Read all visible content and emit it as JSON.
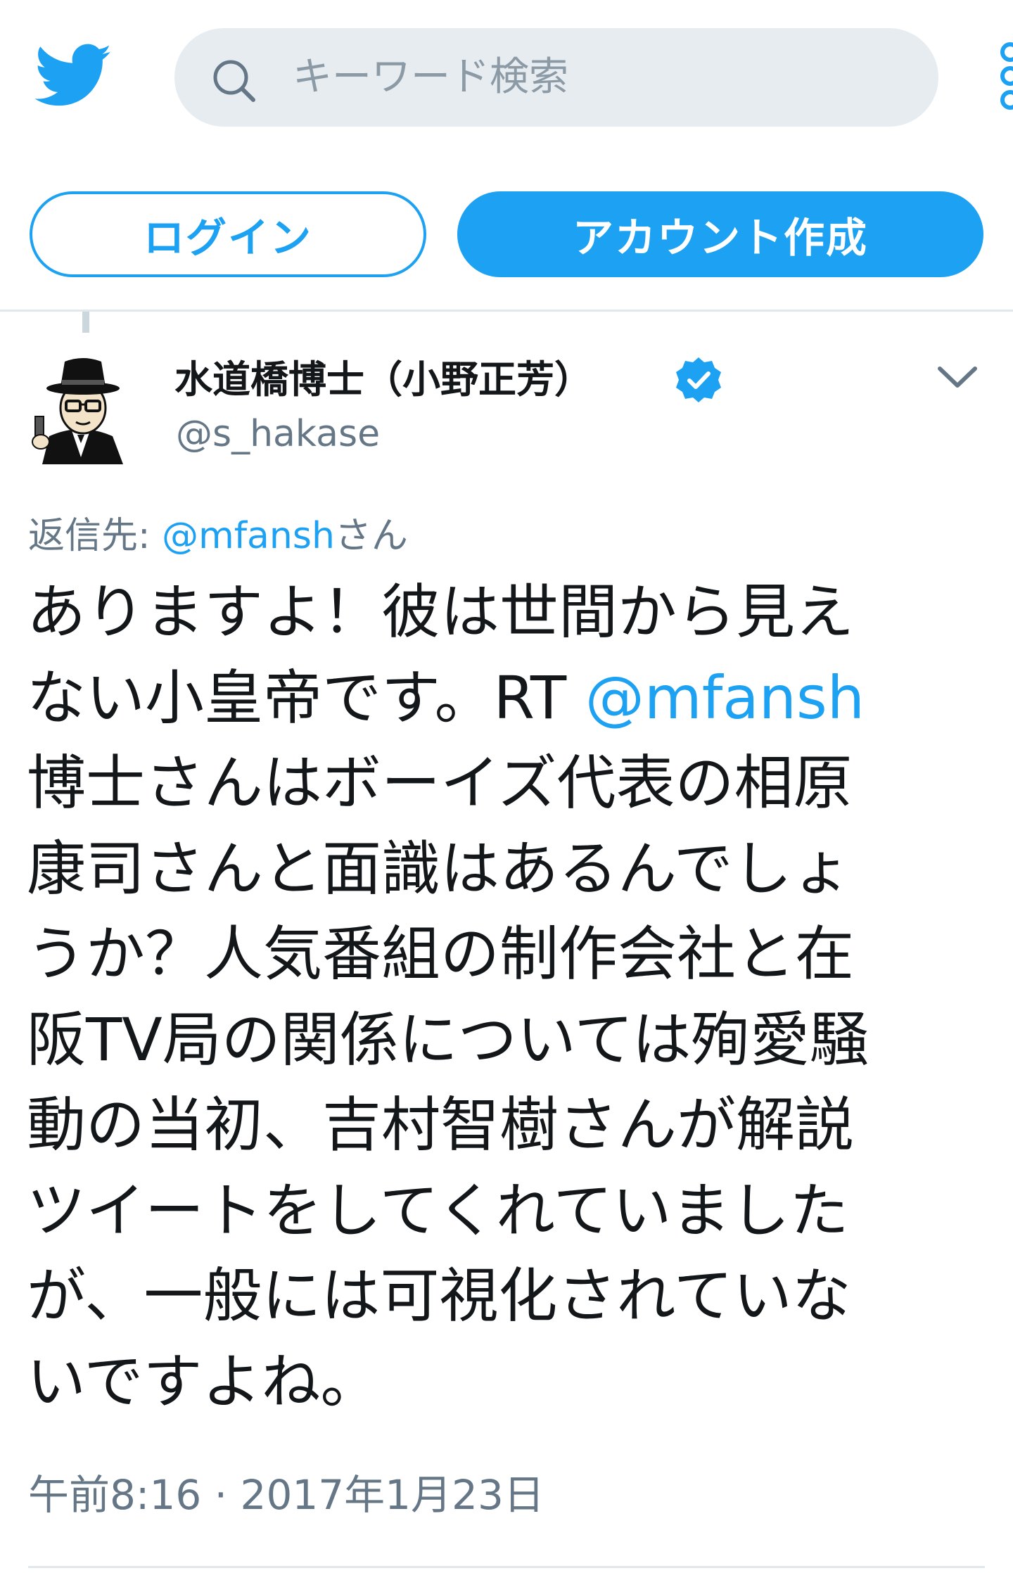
{
  "header": {
    "search_placeholder": "キーワード検索",
    "login_label": "ログイン",
    "signup_label": "アカウント作成"
  },
  "tweet": {
    "author_name": "水道橋博士（小野正芳）",
    "author_handle": "@s_hakase",
    "reply_prefix": "返信先: ",
    "reply_mention": "@mfansh",
    "reply_suffix": "さん",
    "lines": [
      "ありますよ！彼は世間から見え",
      "ない小皇帝です。RT ",
      "博士さんはボーイズ代表の相原",
      "康司さんと面識はあるんでしょ",
      "うか？人気番組の制作会社と在",
      "阪TV局の関係については殉愛騒",
      "動の当初、吉村智樹さんが解説",
      "ツイートをしてくれていました",
      "が、一般には可視化されていな",
      "いですよね。"
    ],
    "inline_mention": "@mfansh",
    "timestamp": "午前8:16 · 2017年1月23日"
  },
  "colors": {
    "brand": "#1da1f2",
    "secondary_text": "#657786",
    "search_bg": "#e6ecf0"
  },
  "icons": {
    "logo": "twitter-bird-icon",
    "search": "search-icon",
    "more": "more-icon",
    "verified": "verified-badge-icon",
    "menu": "chevron-down-icon"
  }
}
